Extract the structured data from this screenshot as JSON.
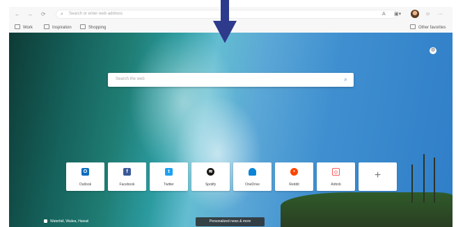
{
  "toolbar": {
    "back_glyph": "←",
    "forward_glyph": "→",
    "refresh_glyph": "⟳",
    "address_placeholder": "Search or enter web address",
    "icons": [
      "search-icon",
      "read-aloud-icon",
      "collections-icon",
      "profile-avatar",
      "emoji-icon",
      "more-icon"
    ]
  },
  "favorites": {
    "items": [
      "Work",
      "Inspiration",
      "Shopping"
    ],
    "other": "Other favorites"
  },
  "main": {
    "search_placeholder": "Search the web",
    "tiles": [
      {
        "label": "Outlook",
        "icon": "outlook-icon",
        "color": "#0f6cbd"
      },
      {
        "label": "Facebook",
        "icon": "facebook-icon",
        "color": "#3b5998"
      },
      {
        "label": "Twitter",
        "icon": "twitter-icon",
        "color": "#1da1f2"
      },
      {
        "label": "Spotify",
        "icon": "spotify-icon",
        "color": "#191414"
      },
      {
        "label": "OneDrive",
        "icon": "onedrive-icon",
        "color": "#0a84d6"
      },
      {
        "label": "Reddit",
        "icon": "reddit-icon",
        "color": "#ff4500"
      },
      {
        "label": "Airbnb",
        "icon": "airbnb-icon",
        "color": "#ff5a5f"
      },
      {
        "label": "",
        "icon": "add-icon",
        "color": "#777777"
      }
    ],
    "add_glyph": "+",
    "bottom_left": "Waterfall, Wailea, Hawaii",
    "news_button": "Personalized news & more"
  },
  "colors": {
    "annotation_arrow": "#2e3a8c"
  }
}
